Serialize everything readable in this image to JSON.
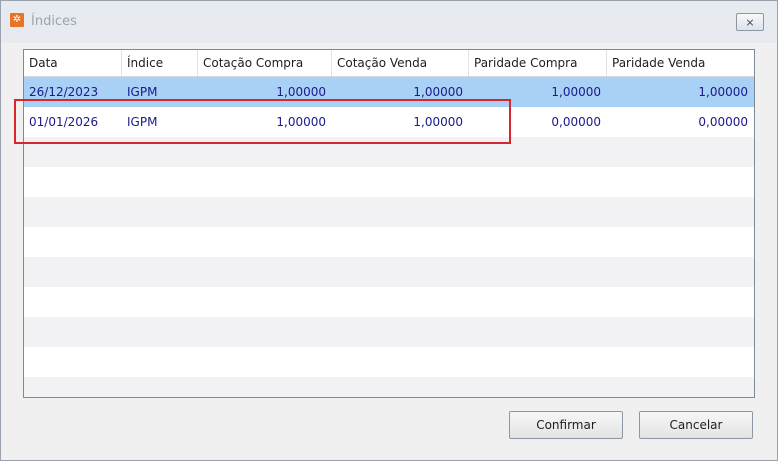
{
  "window": {
    "title": "Índices",
    "icon": "app-logo-icon",
    "close_label": "⨯"
  },
  "grid": {
    "columns": [
      "Data",
      "Índice",
      "Cotação Compra",
      "Cotação Venda",
      "Paridade Compra",
      "Paridade Venda"
    ],
    "rows": [
      {
        "data": "26/12/2023",
        "indice": "IGPM",
        "cotacao_compra": "1,00000",
        "cotacao_venda": "1,00000",
        "paridade_compra": "1,00000",
        "paridade_venda": "1,00000",
        "selected": true
      },
      {
        "data": "01/01/2026",
        "indice": "IGPM",
        "cotacao_compra": "1,00000",
        "cotacao_venda": "1,00000",
        "paridade_compra": "0,00000",
        "paridade_venda": "0,00000",
        "selected": false
      }
    ]
  },
  "buttons": {
    "confirm_label": "Confirmar",
    "cancel_label": "Cancelar"
  },
  "colors": {
    "selected_row": "#a9d0f5",
    "highlight_border": "#d7262e",
    "cell_text": "#1a1a8c"
  }
}
